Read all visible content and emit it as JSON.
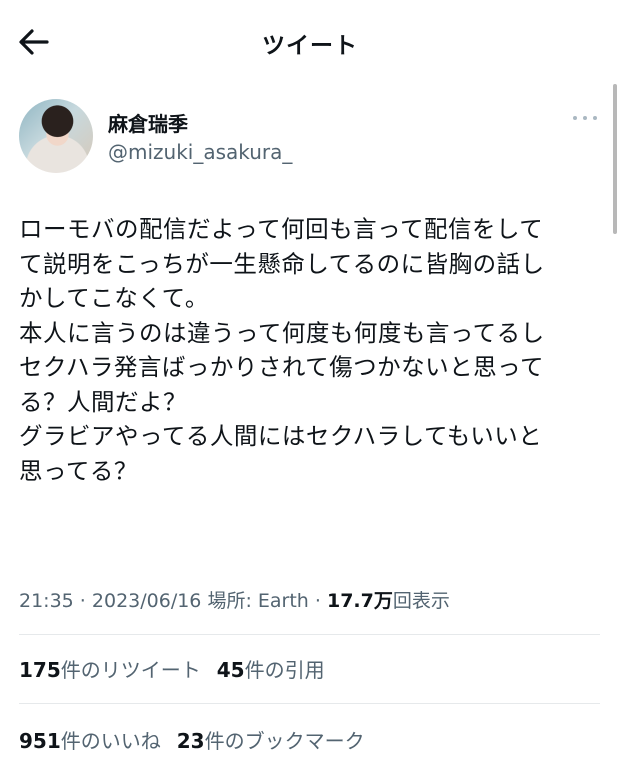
{
  "header": {
    "title": "ツイート",
    "back_icon": "arrow-left-icon"
  },
  "author": {
    "display_name": "麻倉瑞季",
    "handle": "@mizuki_asakura_"
  },
  "tweet": {
    "lines": [
      "ローモバの配信だよって何回も言って配信をして",
      "て説明をこっちが一生懸命してるのに皆胸の話し",
      "かしてこなくて。",
      "本人に言うのは違うって何度も何度も言ってるし",
      "セクハラ発言ばっかりされて傷つかないと思って",
      "る？人間だよ？",
      "グラビアやってる人間にはセクハラしてもいいと",
      "思ってる？"
    ]
  },
  "meta": {
    "time": "21:35",
    "sep1": " · ",
    "date": "2023/06/16",
    "location": " 場所: Earth",
    "sep2": " · ",
    "views_count": "17.7万",
    "views_label": "回表示"
  },
  "stats": {
    "retweets_count": "175",
    "retweets_label": "件のリツイート",
    "quotes_count": "45",
    "quotes_label": "件の引用",
    "likes_count": "951",
    "likes_label": "件のいいね",
    "bookmarks_count": "23",
    "bookmarks_label": "件のブックマーク"
  },
  "colors": {
    "text": "#0f1419",
    "secondary": "#536471",
    "divider": "#e6e9eb"
  }
}
